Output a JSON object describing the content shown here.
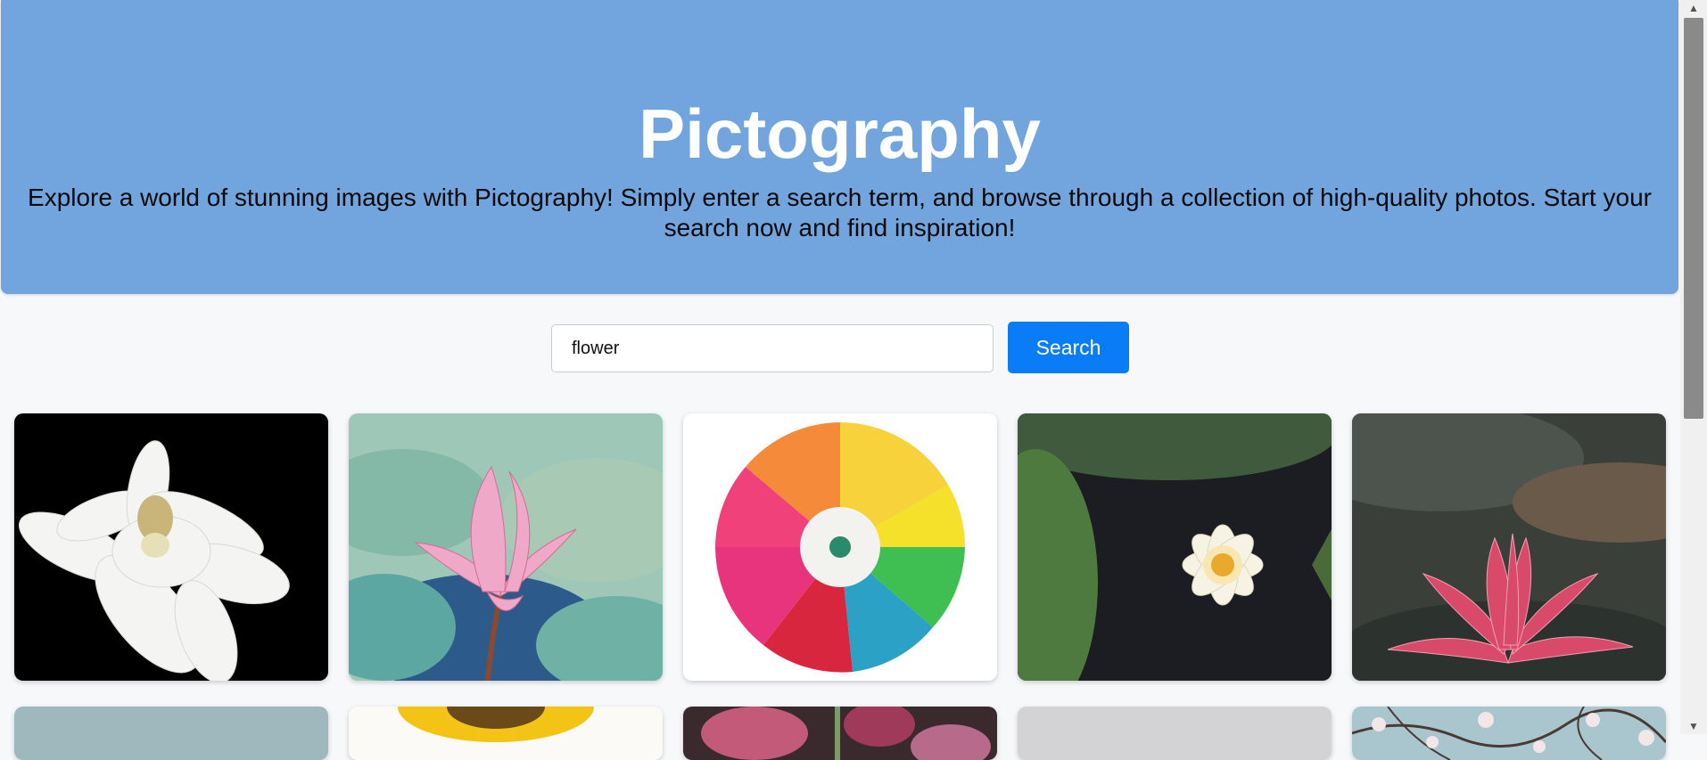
{
  "hero": {
    "title": "Pictography",
    "description": "Explore a world of stunning images with Pictography! Simply enter a search term, and browse through a collection of high-quality photos. Start your search now and find inspiration!"
  },
  "search": {
    "value": "flower",
    "button_label": "Search"
  },
  "results": [
    {
      "subject": "white magnolia on black"
    },
    {
      "subject": "pink lotus over lily pads"
    },
    {
      "subject": "rainbow chrysanthemum"
    },
    {
      "subject": "white water lily on dark water"
    },
    {
      "subject": "pink lotus blossom"
    },
    {
      "subject": "partial image"
    },
    {
      "subject": "sunflower"
    },
    {
      "subject": "pink blossoms"
    },
    {
      "subject": "grey background"
    },
    {
      "subject": "blossoming branches"
    }
  ],
  "colors": {
    "hero_bg": "#72a5dd",
    "button_bg": "#0a7cf5",
    "page_bg": "#f7f8fa"
  },
  "scrollbar": {
    "up_arrow": "triangle-up",
    "down_arrow": "triangle-down"
  }
}
